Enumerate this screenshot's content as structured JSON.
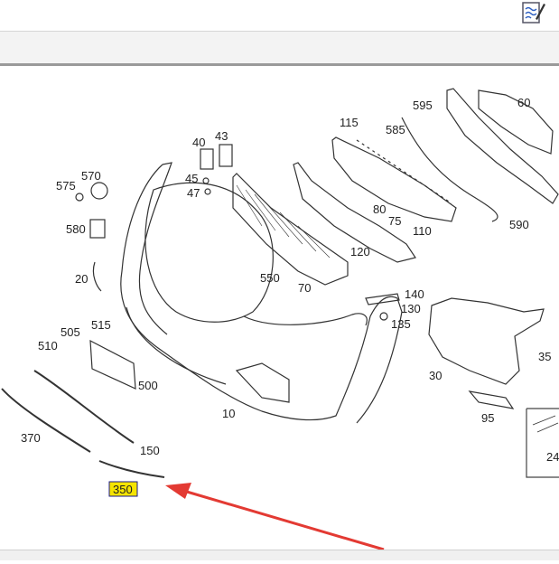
{
  "callouts": {
    "c60": "60",
    "c595": "595",
    "c115": "115",
    "c585": "585",
    "c40": "40",
    "c43": "43",
    "c45": "45",
    "c47": "47",
    "c575": "575",
    "c570": "570",
    "c580": "580",
    "c20": "20",
    "c550": "550",
    "c70": "70",
    "c80": "80",
    "c75": "75",
    "c110": "110",
    "c120": "120",
    "c590": "590",
    "c140": "140",
    "c130": "130",
    "c135": "135",
    "c505": "505",
    "c515": "515",
    "c510": "510",
    "c500": "500",
    "c10": "10",
    "c370": "370",
    "c150": "150",
    "c30": "30",
    "c35": "35",
    "c95": "95",
    "c24": "24",
    "c350": "350"
  },
  "colors": {
    "highlight": "#f5e400",
    "highlight_border": "#1a1a8c",
    "arrow": "#e33a33"
  },
  "icons": {
    "edit": "edit-document-icon"
  }
}
